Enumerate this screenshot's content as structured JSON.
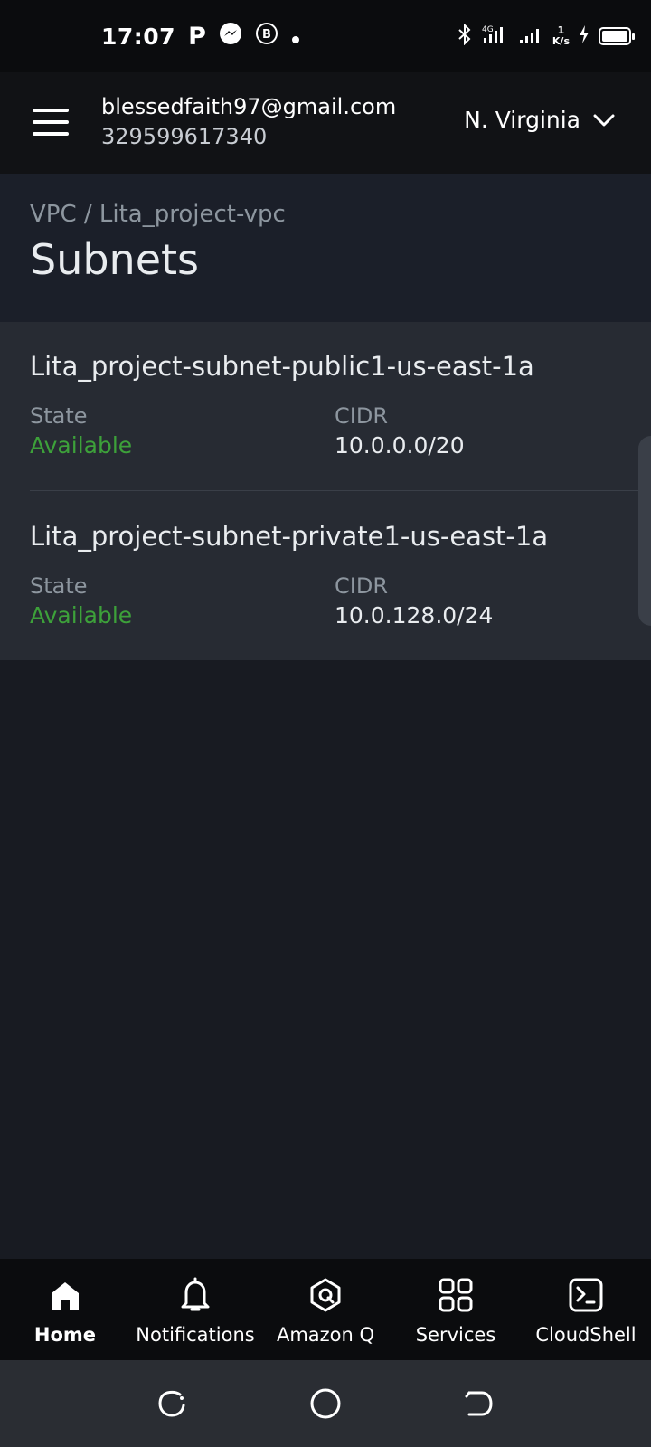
{
  "status_bar": {
    "time": "17:07",
    "app_icons": [
      "parking-icon",
      "messenger-icon",
      "business-icon",
      "dot-icon"
    ],
    "network_speed_value": "1",
    "network_speed_unit": "K/s"
  },
  "header": {
    "email": "blessedfaith97@gmail.com",
    "account_id": "329599617340",
    "region": "N. Virginia"
  },
  "page": {
    "breadcrumb": "VPC / Lita_project-vpc",
    "title": "Subnets"
  },
  "subnets": [
    {
      "name": "Lita_project-subnet-public1-us-east-1a",
      "state_label": "State",
      "state": "Available",
      "cidr_label": "CIDR",
      "cidr": "10.0.0.0/20"
    },
    {
      "name": "Lita_project-subnet-private1-us-east-1a",
      "state_label": "State",
      "state": "Available",
      "cidr_label": "CIDR",
      "cidr": "10.0.128.0/24"
    }
  ],
  "bottom_nav": {
    "items": [
      {
        "label": "Home",
        "icon": "home-icon",
        "active": true
      },
      {
        "label": "Notifications",
        "icon": "bell-icon",
        "active": false
      },
      {
        "label": "Amazon Q",
        "icon": "amazon-q-icon",
        "active": false
      },
      {
        "label": "Services",
        "icon": "grid-icon",
        "active": false
      },
      {
        "label": "CloudShell",
        "icon": "terminal-icon",
        "active": false
      }
    ]
  },
  "colors": {
    "available_green": "#3da13a",
    "page_bg": "#181b22",
    "card_bg": "#272b33"
  }
}
